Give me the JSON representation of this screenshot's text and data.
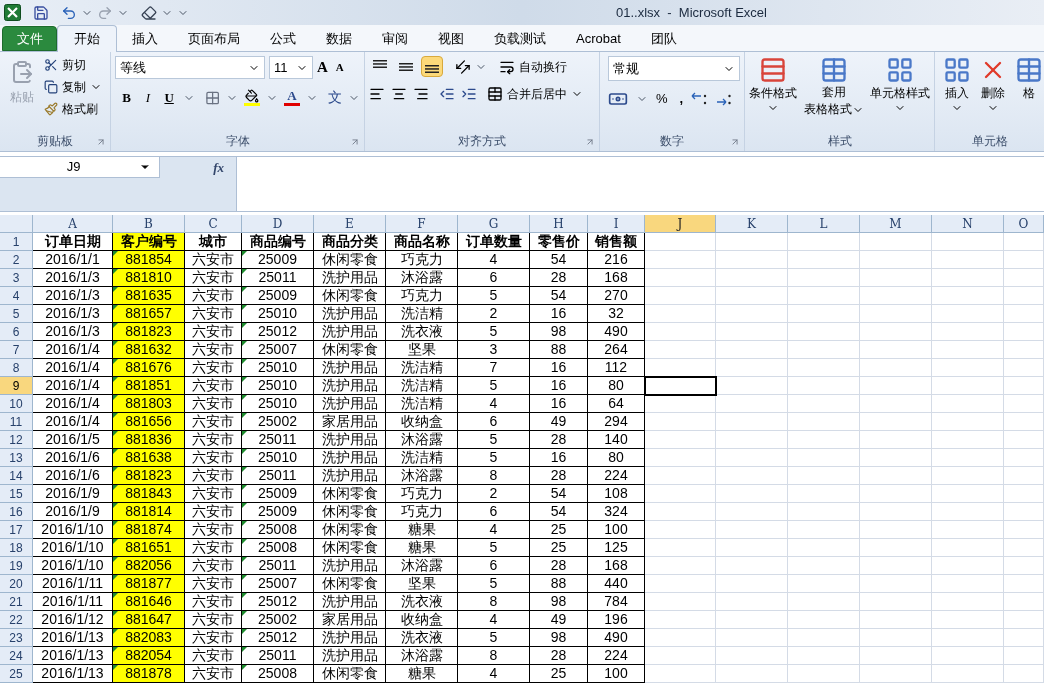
{
  "title_bar": {
    "title": "01..xlsx  -  Microsoft Excel"
  },
  "ribbon_tabs": [
    {
      "label": "文件",
      "kind": "file",
      "selected": false
    },
    {
      "label": "开始",
      "kind": "tab",
      "selected": true
    },
    {
      "label": "插入",
      "kind": "tab",
      "selected": false
    },
    {
      "label": "页面布局",
      "kind": "tab",
      "selected": false
    },
    {
      "label": "公式",
      "kind": "tab",
      "selected": false
    },
    {
      "label": "数据",
      "kind": "tab",
      "selected": false
    },
    {
      "label": "审阅",
      "kind": "tab",
      "selected": false
    },
    {
      "label": "视图",
      "kind": "tab",
      "selected": false
    },
    {
      "label": "负载测试",
      "kind": "tab",
      "selected": false
    },
    {
      "label": "Acrobat",
      "kind": "tab",
      "selected": false
    },
    {
      "label": "团队",
      "kind": "tab",
      "selected": false
    }
  ],
  "clipboard": {
    "label": "剪贴板",
    "paste": "粘贴",
    "cut": "剪切",
    "copy": "复制",
    "format_painter": "格式刷"
  },
  "font": {
    "label": "字体",
    "font_name": "等线",
    "font_size": "11",
    "grow": "A",
    "shrink": "A",
    "bold": "B",
    "italic": "I",
    "underline": "U",
    "font_color": "A",
    "phonetic": "文"
  },
  "alignment": {
    "label": "对齐方式",
    "vertical": [
      {
        "kind": "top",
        "selected": false
      },
      {
        "kind": "middle",
        "selected": false
      },
      {
        "kind": "bottom",
        "selected": true
      }
    ],
    "wrap_text": "自动换行",
    "merge": "合并后居中"
  },
  "number": {
    "label": "数字",
    "format": "常规",
    "percent": "%",
    "comma": ","
  },
  "styles": {
    "label": "样式",
    "conditional": "条件格式",
    "table_line1": "套用",
    "table_line2": "表格格式",
    "cell_styles": "单元格样式"
  },
  "cells": {
    "label": "单元格",
    "insert": "插入",
    "delete": "删除",
    "format": "格"
  },
  "name_box": "J9",
  "function_label": "fx",
  "columns": [
    {
      "label": "A",
      "selected": false,
      "text_marker": false
    },
    {
      "label": "B",
      "selected": false,
      "text_marker": true,
      "color": "#ffff00"
    },
    {
      "label": "C",
      "selected": false,
      "text_marker": false
    },
    {
      "label": "D",
      "selected": false,
      "text_marker": true
    },
    {
      "label": "E",
      "selected": false,
      "text_marker": false
    },
    {
      "label": "F",
      "selected": false,
      "text_marker": false
    },
    {
      "label": "G",
      "selected": false,
      "text_marker": false
    },
    {
      "label": "H",
      "selected": false,
      "text_marker": false
    },
    {
      "label": "I",
      "selected": false,
      "text_marker": false
    },
    {
      "label": "J",
      "selected": true,
      "text_marker": false
    },
    {
      "label": "K",
      "selected": false,
      "text_marker": false
    },
    {
      "label": "L",
      "selected": false,
      "text_marker": false
    },
    {
      "label": "M",
      "selected": false,
      "text_marker": false
    },
    {
      "label": "N",
      "selected": false,
      "text_marker": false
    },
    {
      "label": "O",
      "selected": false,
      "text_marker": false
    }
  ],
  "rows": [
    {
      "number": "1",
      "kind": "header",
      "selected": false,
      "cells": [
        "订单日期",
        "客户编号",
        "城市",
        "商品编号",
        "商品分类",
        "商品名称",
        "订单数量",
        "零售价",
        "销售额"
      ]
    },
    {
      "number": "2",
      "kind": "data",
      "selected": false,
      "cells": [
        "2016/1/1",
        "881854",
        "六安市",
        "25009",
        "休闲零食",
        "巧克力",
        "4",
        "54",
        "216"
      ]
    },
    {
      "number": "3",
      "kind": "data",
      "selected": false,
      "cells": [
        "2016/1/3",
        "881810",
        "六安市",
        "25011",
        "洗护用品",
        "沐浴露",
        "6",
        "28",
        "168"
      ]
    },
    {
      "number": "4",
      "kind": "data",
      "selected": false,
      "cells": [
        "2016/1/3",
        "881635",
        "六安市",
        "25009",
        "休闲零食",
        "巧克力",
        "5",
        "54",
        "270"
      ]
    },
    {
      "number": "5",
      "kind": "data",
      "selected": false,
      "cells": [
        "2016/1/3",
        "881657",
        "六安市",
        "25010",
        "洗护用品",
        "洗洁精",
        "2",
        "16",
        "32"
      ]
    },
    {
      "number": "6",
      "kind": "data",
      "selected": false,
      "cells": [
        "2016/1/3",
        "881823",
        "六安市",
        "25012",
        "洗护用品",
        "洗衣液",
        "5",
        "98",
        "490"
      ]
    },
    {
      "number": "7",
      "kind": "data",
      "selected": false,
      "cells": [
        "2016/1/4",
        "881632",
        "六安市",
        "25007",
        "休闲零食",
        "坚果",
        "3",
        "88",
        "264"
      ]
    },
    {
      "number": "8",
      "kind": "data",
      "selected": false,
      "cells": [
        "2016/1/4",
        "881676",
        "六安市",
        "25010",
        "洗护用品",
        "洗洁精",
        "7",
        "16",
        "112"
      ]
    },
    {
      "number": "9",
      "kind": "data",
      "selected": true,
      "cells": [
        "2016/1/4",
        "881851",
        "六安市",
        "25010",
        "洗护用品",
        "洗洁精",
        "5",
        "16",
        "80"
      ]
    },
    {
      "number": "10",
      "kind": "data",
      "selected": false,
      "cells": [
        "2016/1/4",
        "881803",
        "六安市",
        "25010",
        "洗护用品",
        "洗洁精",
        "4",
        "16",
        "64"
      ]
    },
    {
      "number": "11",
      "kind": "data",
      "selected": false,
      "cells": [
        "2016/1/4",
        "881656",
        "六安市",
        "25002",
        "家居用品",
        "收纳盒",
        "6",
        "49",
        "294"
      ]
    },
    {
      "number": "12",
      "kind": "data",
      "selected": false,
      "cells": [
        "2016/1/5",
        "881836",
        "六安市",
        "25011",
        "洗护用品",
        "沐浴露",
        "5",
        "28",
        "140"
      ]
    },
    {
      "number": "13",
      "kind": "data",
      "selected": false,
      "cells": [
        "2016/1/6",
        "881638",
        "六安市",
        "25010",
        "洗护用品",
        "洗洁精",
        "5",
        "16",
        "80"
      ]
    },
    {
      "number": "14",
      "kind": "data",
      "selected": false,
      "cells": [
        "2016/1/6",
        "881823",
        "六安市",
        "25011",
        "洗护用品",
        "沐浴露",
        "8",
        "28",
        "224"
      ]
    },
    {
      "number": "15",
      "kind": "data",
      "selected": false,
      "cells": [
        "2016/1/9",
        "881843",
        "六安市",
        "25009",
        "休闲零食",
        "巧克力",
        "2",
        "54",
        "108"
      ]
    },
    {
      "number": "16",
      "kind": "data",
      "selected": false,
      "cells": [
        "2016/1/9",
        "881814",
        "六安市",
        "25009",
        "休闲零食",
        "巧克力",
        "6",
        "54",
        "324"
      ]
    },
    {
      "number": "17",
      "kind": "data",
      "selected": false,
      "cells": [
        "2016/1/10",
        "881874",
        "六安市",
        "25008",
        "休闲零食",
        "糖果",
        "4",
        "25",
        "100"
      ]
    },
    {
      "number": "18",
      "kind": "data",
      "selected": false,
      "cells": [
        "2016/1/10",
        "881651",
        "六安市",
        "25008",
        "休闲零食",
        "糖果",
        "5",
        "25",
        "125"
      ]
    },
    {
      "number": "19",
      "kind": "data",
      "selected": false,
      "cells": [
        "2016/1/10",
        "882056",
        "六安市",
        "25011",
        "洗护用品",
        "沐浴露",
        "6",
        "28",
        "168"
      ]
    },
    {
      "number": "20",
      "kind": "data",
      "selected": false,
      "cells": [
        "2016/1/11",
        "881877",
        "六安市",
        "25007",
        "休闲零食",
        "坚果",
        "5",
        "88",
        "440"
      ]
    },
    {
      "number": "21",
      "kind": "data",
      "selected": false,
      "cells": [
        "2016/1/11",
        "881646",
        "六安市",
        "25012",
        "洗护用品",
        "洗衣液",
        "8",
        "98",
        "784"
      ]
    },
    {
      "number": "22",
      "kind": "data",
      "selected": false,
      "cells": [
        "2016/1/12",
        "881647",
        "六安市",
        "25002",
        "家居用品",
        "收纳盒",
        "4",
        "49",
        "196"
      ]
    },
    {
      "number": "23",
      "kind": "data",
      "selected": false,
      "cells": [
        "2016/1/13",
        "882083",
        "六安市",
        "25012",
        "洗护用品",
        "洗衣液",
        "5",
        "98",
        "490"
      ]
    },
    {
      "number": "24",
      "kind": "data",
      "selected": false,
      "cells": [
        "2016/1/13",
        "882054",
        "六安市",
        "25011",
        "洗护用品",
        "沐浴露",
        "8",
        "28",
        "224"
      ]
    },
    {
      "number": "25",
      "kind": "data",
      "selected": false,
      "cells": [
        "2016/1/13",
        "881878",
        "六安市",
        "25008",
        "休闲零食",
        "糖果",
        "4",
        "25",
        "100"
      ]
    }
  ]
}
